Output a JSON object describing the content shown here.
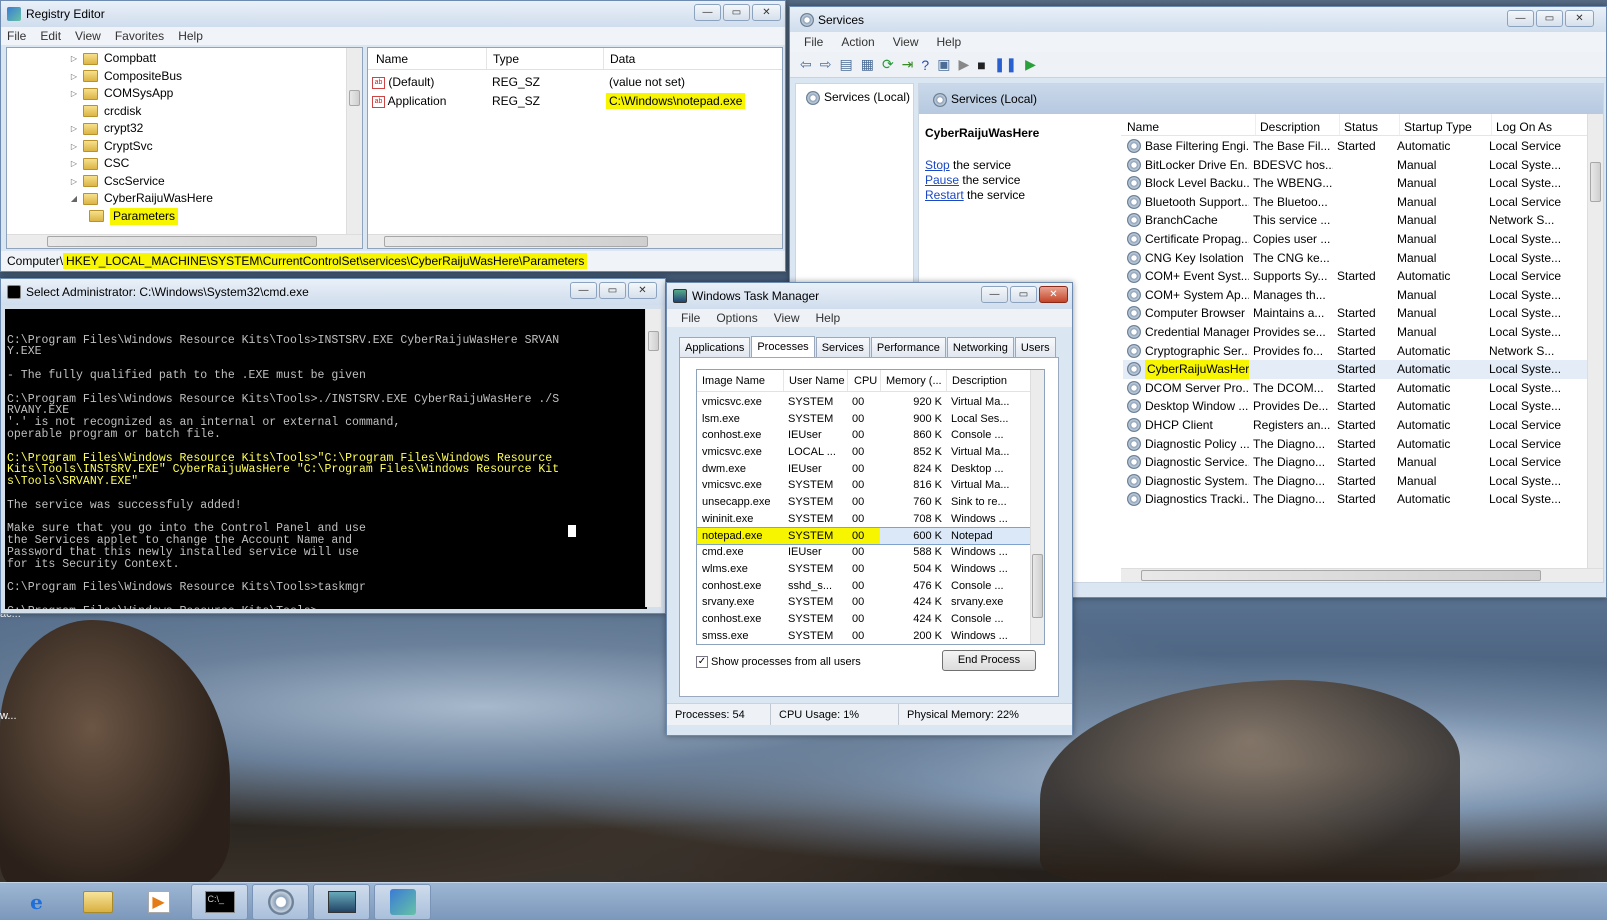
{
  "regedit": {
    "title": "Registry Editor",
    "menu": [
      "File",
      "Edit",
      "View",
      "Favorites",
      "Help"
    ],
    "tree": [
      "Compbatt",
      "CompositeBus",
      "COMSysApp",
      "crcdisk",
      "crypt32",
      "CryptSvc",
      "CSC",
      "CscService",
      "CyberRaijuWasHere",
      "Parameters"
    ],
    "columns": [
      "Name",
      "Type",
      "Data"
    ],
    "values": [
      {
        "name": "(Default)",
        "type": "REG_SZ",
        "data": "(value not set)"
      },
      {
        "name": "Application",
        "type": "REG_SZ",
        "data": "C:\\Windows\\notepad.exe"
      }
    ],
    "status_prefix": "Computer\\",
    "status_path": "HKEY_LOCAL_MACHINE\\SYSTEM\\CurrentControlSet\\services\\CyberRaijuWasHere\\Parameters"
  },
  "cmd": {
    "title": "Select Administrator: C:\\Windows\\System32\\cmd.exe",
    "lines": [
      "C:\\Program Files\\Windows Resource Kits\\Tools>INSTSRV.EXE CyberRaijuWasHere SRVAN",
      "Y.EXE",
      "",
      "- The fully qualified path to the .EXE must be given",
      "",
      "C:\\Program Files\\Windows Resource Kits\\Tools>./INSTSRV.EXE CyberRaijuWasHere ./S",
      "RVANY.EXE",
      "'.' is not recognized as an internal or external command,",
      "operable program or batch file.",
      "",
      "C:\\Program Files\\Windows Resource Kits\\Tools>\"C:\\Program Files\\Windows Resource",
      "Kits\\Tools\\INSTSRV.EXE\" CyberRaijuWasHere \"C:\\Program Files\\Windows Resource Kit",
      "s\\Tools\\SRVANY.EXE\"",
      "",
      "The service was successfuly added!",
      "",
      "Make sure that you go into the Control Panel and use",
      "the Services applet to change the Account Name and",
      "Password that this newly installed service will use",
      "for its Security Context.",
      "",
      "C:\\Program Files\\Windows Resource Kits\\Tools>taskmgr",
      "",
      "C:\\Program Files\\Windows Resource Kits\\Tools>"
    ]
  },
  "taskmgr": {
    "title": "Windows Task Manager",
    "menu": [
      "File",
      "Options",
      "View",
      "Help"
    ],
    "tabs": [
      "Applications",
      "Processes",
      "Services",
      "Performance",
      "Networking",
      "Users"
    ],
    "columns": [
      "Image Name",
      "User Name",
      "CPU",
      "Memory (...",
      "Description"
    ],
    "rows": [
      [
        "vmicsvc.exe",
        "SYSTEM",
        "00",
        "920 K",
        "Virtual Ma..."
      ],
      [
        "lsm.exe",
        "SYSTEM",
        "00",
        "900 K",
        "Local Ses..."
      ],
      [
        "conhost.exe",
        "IEUser",
        "00",
        "860 K",
        "Console ..."
      ],
      [
        "vmicsvc.exe",
        "LOCAL ...",
        "00",
        "852 K",
        "Virtual Ma..."
      ],
      [
        "dwm.exe",
        "IEUser",
        "00",
        "824 K",
        "Desktop ..."
      ],
      [
        "vmicsvc.exe",
        "SYSTEM",
        "00",
        "816 K",
        "Virtual Ma..."
      ],
      [
        "unsecapp.exe",
        "SYSTEM",
        "00",
        "760 K",
        "Sink to re..."
      ],
      [
        "wininit.exe",
        "SYSTEM",
        "00",
        "708 K",
        "Windows ..."
      ],
      [
        "notepad.exe",
        "SYSTEM",
        "00",
        "600 K",
        "Notepad"
      ],
      [
        "cmd.exe",
        "IEUser",
        "00",
        "588 K",
        "Windows ..."
      ],
      [
        "wlms.exe",
        "SYSTEM",
        "00",
        "504 K",
        "Windows ..."
      ],
      [
        "conhost.exe",
        "sshd_s...",
        "00",
        "476 K",
        "Console ..."
      ],
      [
        "srvany.exe",
        "SYSTEM",
        "00",
        "424 K",
        "srvany.exe"
      ],
      [
        "conhost.exe",
        "SYSTEM",
        "00",
        "424 K",
        "Console ..."
      ],
      [
        "smss.exe",
        "SYSTEM",
        "00",
        "200 K",
        "Windows ..."
      ]
    ],
    "show_all": "Show processes from all users",
    "end_process": "End Process",
    "status": [
      "Processes: 54",
      "CPU Usage: 1%",
      "Physical Memory: 22%"
    ]
  },
  "services": {
    "title": "Services",
    "menu": [
      "File",
      "Action",
      "View",
      "Help"
    ],
    "tree_item": "Services (Local)",
    "header": "Services (Local)",
    "selected": "CyberRaijuWasHere",
    "actions": [
      {
        "link": "Stop",
        "rest": " the service"
      },
      {
        "link": "Pause",
        "rest": " the service"
      },
      {
        "link": "Restart",
        "rest": " the service"
      }
    ],
    "columns": [
      "Name",
      "Description",
      "Status",
      "Startup Type",
      "Log On As"
    ],
    "rows": [
      [
        "Base Filtering Engi...",
        "The Base Fil...",
        "Started",
        "Automatic",
        "Local Service"
      ],
      [
        "BitLocker Drive En...",
        "BDESVC hos...",
        "",
        "Manual",
        "Local Syste..."
      ],
      [
        "Block Level Backu...",
        "The WBENG...",
        "",
        "Manual",
        "Local Syste..."
      ],
      [
        "Bluetooth Support...",
        "The Bluetoo...",
        "",
        "Manual",
        "Local Service"
      ],
      [
        "BranchCache",
        "This service ...",
        "",
        "Manual",
        "Network S..."
      ],
      [
        "Certificate Propag...",
        "Copies user ...",
        "",
        "Manual",
        "Local Syste..."
      ],
      [
        "CNG Key Isolation",
        "The CNG ke...",
        "",
        "Manual",
        "Local Syste..."
      ],
      [
        "COM+ Event Syst...",
        "Supports Sy...",
        "Started",
        "Automatic",
        "Local Service"
      ],
      [
        "COM+ System Ap...",
        "Manages th...",
        "",
        "Manual",
        "Local Syste..."
      ],
      [
        "Computer Browser",
        "Maintains a...",
        "Started",
        "Manual",
        "Local Syste..."
      ],
      [
        "Credential Manager",
        "Provides se...",
        "Started",
        "Manual",
        "Local Syste..."
      ],
      [
        "Cryptographic Ser...",
        "Provides fo...",
        "Started",
        "Automatic",
        "Network S..."
      ],
      [
        "CyberRaijuWasHere",
        "",
        "Started",
        "Automatic",
        "Local Syste..."
      ],
      [
        "DCOM Server Pro...",
        "The DCOM...",
        "Started",
        "Automatic",
        "Local Syste..."
      ],
      [
        "Desktop Window ...",
        "Provides De...",
        "Started",
        "Automatic",
        "Local Syste..."
      ],
      [
        "DHCP Client",
        "Registers an...",
        "Started",
        "Automatic",
        "Local Service"
      ],
      [
        "Diagnostic Policy ...",
        "The Diagno...",
        "Started",
        "Automatic",
        "Local Service"
      ],
      [
        "Diagnostic Service...",
        "The Diagno...",
        "Started",
        "Manual",
        "Local Service"
      ],
      [
        "Diagnostic System...",
        "The Diagno...",
        "Started",
        "Manual",
        "Local Syste..."
      ],
      [
        "Diagnostics Tracki...",
        "The Diagno...",
        "Started",
        "Automatic",
        "Local Syste..."
      ]
    ]
  },
  "desktop_fragments": [
    "ac...",
    "w..."
  ],
  "colors": {
    "highlight": "#f7f500",
    "cmd_bg": "#000000",
    "cmd_text": "#c0c0c0",
    "cmd_yellow": "#ffff55"
  }
}
